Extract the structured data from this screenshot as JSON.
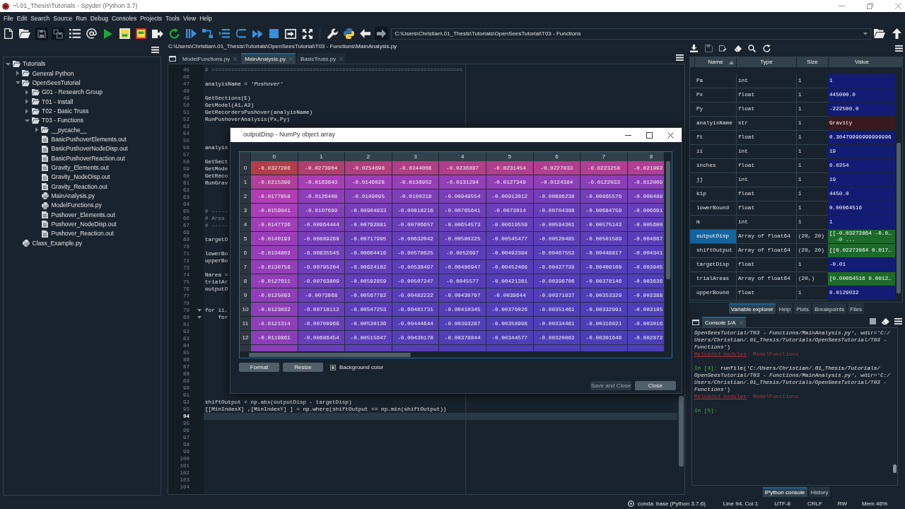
{
  "window": {
    "title": "~\\.01_Thesis\\Tutorials - Spyder (Python 3.7)"
  },
  "menu": [
    "File",
    "Edit",
    "Search",
    "Source",
    "Run",
    "Debug",
    "Consoles",
    "Projects",
    "Tools",
    "View",
    "Help"
  ],
  "toolbar": {
    "path": "C:\\Users\\Christian\\.01_Thesis\\Tutorials\\OpenSeesTutorial\\T03 - Functions"
  },
  "project_tree": {
    "items": [
      {
        "label": "Tutorials",
        "kind": "folder",
        "expanded": true,
        "children": [
          {
            "label": "General Python",
            "kind": "folder",
            "expanded": false
          },
          {
            "label": "OpenSeesTutorial",
            "kind": "folder",
            "expanded": true,
            "children": [
              {
                "label": "G01 - Research Group",
                "kind": "folder",
                "expanded": false
              },
              {
                "label": "T01 - Install",
                "kind": "folder",
                "expanded": false
              },
              {
                "label": "T02 - Basic Truss",
                "kind": "folder",
                "expanded": false
              },
              {
                "label": "T03 - Functions",
                "kind": "folder",
                "expanded": true,
                "children": [
                  {
                    "label": "__pycache__",
                    "kind": "folder",
                    "expanded": false
                  },
                  {
                    "label": "BasicPushoverElements.out",
                    "kind": "file"
                  },
                  {
                    "label": "BasicPushoverNodeDisp.out",
                    "kind": "file"
                  },
                  {
                    "label": "BasicPushoverReaction.out",
                    "kind": "file"
                  },
                  {
                    "label": "Gravity_Elements.out",
                    "kind": "file"
                  },
                  {
                    "label": "Gravity_NodeDisp.out",
                    "kind": "file"
                  },
                  {
                    "label": "Gravity_Reaction.out",
                    "kind": "file"
                  },
                  {
                    "label": "MainAnalysis.py",
                    "kind": "python"
                  },
                  {
                    "label": "ModelFunctions.py",
                    "kind": "python"
                  },
                  {
                    "label": "Pushover_Elements.out",
                    "kind": "file"
                  },
                  {
                    "label": "Pushover_NodeDisp.out",
                    "kind": "file"
                  },
                  {
                    "label": "Pushover_Reaction.out",
                    "kind": "file"
                  }
                ]
              }
            ]
          },
          {
            "label": "Class_Example.py",
            "kind": "python"
          }
        ]
      }
    ]
  },
  "editor": {
    "path": "C:\\Users\\Christian\\.01_Thesis\\Tutorials\\OpenSeesTutorial\\T03 - Functions\\MainAnalysis.py",
    "tabs": [
      {
        "label": "ModelFunctions.py",
        "selected": false
      },
      {
        "label": "MainAnalysis.py",
        "selected": true
      },
      {
        "label": "BasicTruss.py",
        "selected": false
      }
    ],
    "lines": [
      {
        "number": "45",
        "kind": "comment",
        "text": "# =============================================================================",
        "current": false
      },
      {
        "number": "46",
        "kind": "blank",
        "current": false
      },
      {
        "number": "47",
        "kind": "code",
        "text": "analyisName = *'Pushover'*",
        "current": false
      },
      {
        "number": "48",
        "kind": "blank",
        "current": false
      },
      {
        "number": "49",
        "kind": "code",
        "text": "GetSections(E)",
        "current": false
      },
      {
        "number": "50",
        "kind": "code",
        "text": "GetModel(A1,A2)",
        "current": false
      },
      {
        "number": "51",
        "kind": "code",
        "text": "GetRecordersPushover(analyisName)",
        "current": false
      },
      {
        "number": "52",
        "kind": "code",
        "text": "RunPushoverAnalysis(Px,Py)",
        "current": false
      },
      {
        "number": "53",
        "kind": "blank",
        "current": false
      },
      {
        "number": "54",
        "kind": "blank",
        "current": false
      },
      {
        "number": "55",
        "kind": "blank",
        "current": false
      },
      {
        "number": "56",
        "kind": "code",
        "text": "analyis",
        "current": false
      },
      {
        "number": "57",
        "kind": "blank",
        "current": false
      },
      {
        "number": "58",
        "kind": "code",
        "text": "GetSect",
        "current": false
      },
      {
        "number": "59",
        "kind": "code",
        "text": "GetMode",
        "current": false
      },
      {
        "number": "60",
        "kind": "code",
        "text": "GetReco",
        "current": false
      },
      {
        "number": "61",
        "kind": "code",
        "text": "RunGrav",
        "current": false
      },
      {
        "number": "62",
        "kind": "blank",
        "current": false
      },
      {
        "number": "63",
        "kind": "blank",
        "current": false
      },
      {
        "number": "64",
        "kind": "blank",
        "current": false
      },
      {
        "number": "65",
        "kind": "comment",
        "text": "# -----",
        "current": false
      },
      {
        "number": "66",
        "kind": "comment",
        "text": "# Area",
        "current": false
      },
      {
        "number": "67",
        "kind": "comment",
        "text": "# -----",
        "current": false
      },
      {
        "number": "68",
        "kind": "blank",
        "current": false
      },
      {
        "number": "69",
        "kind": "code",
        "text": "targetD",
        "current": false
      },
      {
        "number": "70",
        "kind": "blank",
        "current": false
      },
      {
        "number": "71",
        "kind": "code",
        "text": "lowerBo",
        "current": false
      },
      {
        "number": "72",
        "kind": "code",
        "text": "upperBo",
        "current": false
      },
      {
        "number": "73",
        "kind": "blank",
        "current": false
      },
      {
        "number": "74",
        "kind": "code",
        "text": "Narea =",
        "current": false
      },
      {
        "number": "75",
        "kind": "code",
        "text": "trialAr",
        "current": false
      },
      {
        "number": "76",
        "kind": "code",
        "text": "outputD",
        "current": false
      },
      {
        "number": "77",
        "kind": "blank",
        "current": false
      },
      {
        "number": "78",
        "kind": "blank",
        "current": false
      },
      {
        "number": "79",
        "kind": "block_start",
        "text": "for ii,",
        "current": false
      },
      {
        "number": "80",
        "kind": "block_start",
        "text": "    for",
        "current": false
      },
      {
        "number": "81",
        "kind": "blank",
        "current": false
      },
      {
        "number": "82",
        "kind": "blank",
        "current": false
      },
      {
        "number": "83",
        "kind": "blank",
        "current": false
      },
      {
        "number": "84",
        "kind": "blank",
        "current": false
      },
      {
        "number": "85",
        "kind": "blank",
        "current": false
      },
      {
        "number": "86",
        "kind": "blank",
        "current": false
      },
      {
        "number": "87",
        "kind": "blank",
        "current": false
      },
      {
        "number": "88",
        "kind": "blank",
        "current": false
      },
      {
        "number": "89",
        "kind": "blank",
        "current": false
      },
      {
        "number": "90",
        "kind": "blank",
        "current": false
      },
      {
        "number": "91",
        "kind": "blank",
        "current": false
      },
      {
        "number": "92",
        "kind": "code",
        "text": "shiftOutput = np.abs(outputDisp - targetDisp)",
        "current": false
      },
      {
        "number": "93",
        "kind": "code",
        "text": "[[MinIndexX] ,[MinIndexY] ] = np.where(shiftOutput == np.min(shiftOutput))",
        "current": false
      },
      {
        "number": "94",
        "kind": "blank",
        "current": true
      },
      {
        "number": "95",
        "kind": "blank",
        "current": false
      },
      {
        "number": "96",
        "kind": "blank",
        "current": false
      },
      {
        "number": "97",
        "kind": "blank",
        "current": false
      },
      {
        "number": "98",
        "kind": "blank",
        "current": false
      },
      {
        "number": "99",
        "kind": "blank",
        "current": false
      },
      {
        "number": "100",
        "kind": "blank",
        "current": false
      },
      {
        "number": "101",
        "kind": "blank",
        "current": false
      },
      {
        "number": "102",
        "kind": "blank",
        "current": false
      },
      {
        "number": "103",
        "kind": "blank",
        "current": false
      },
      {
        "number": "104",
        "kind": "blank",
        "current": false
      }
    ]
  },
  "array_editor": {
    "title": "outputDisp - NumPy object array",
    "columns": [
      "0",
      "1",
      "2",
      "3",
      "4",
      "5",
      "6",
      "7",
      "8"
    ],
    "rows": [
      {
        "header": "0",
        "cells": [
          "-0.0327286",
          "-0.0273904",
          "-0.0254698",
          "-0.0244066",
          "-0.0236887",
          "-0.0231454",
          "-0.0227033",
          "-0.0223258",
          "-0.021992"
        ]
      },
      {
        "header": "1",
        "cells": [
          "-0.0215399",
          "-0.0163643",
          "-0.0146028",
          "-0.0136952",
          "-0.0131294",
          "-0.0127349",
          "-0.0124384",
          "-0.0122033",
          "-0.012009"
        ]
      },
      {
        "header": "2",
        "cells": [
          "-0.0177858",
          "-0.0126408",
          "-0.0109095",
          "-0.0100318",
          "-0.00949554",
          "-0.00913012",
          "-0.00886238",
          "-0.00865576",
          "-0.008489"
        ]
      },
      {
        "header": "3",
        "cells": [
          "-0.0159041",
          "-0.0107699",
          "-0.00904933",
          "-0.00818216",
          "-0.00765641",
          "-0.0073014",
          "-0.00704398",
          "-0.00684759",
          "-0.006691"
        ]
      },
      {
        "header": "4",
        "cells": [
          "-0.0147736",
          "-0.00964444",
          "-0.00792881",
          "-0.00706657",
          "-0.00654573",
          "-0.00619559",
          "-0.00594301",
          "-0.00575143",
          "-0.005600"
        ]
      },
      {
        "header": "5",
        "cells": [
          "-0.0140193",
          "-0.00889288",
          "-0.00717995",
          "-0.00632042",
          "-0.00580225",
          "-0.00545477",
          "-0.00520485",
          "-0.00501589",
          "-0.004867"
        ]
      },
      {
        "header": "6",
        "cells": [
          "-0.0134802",
          "-0.00835545",
          "-0.00664416",
          "-0.00578625",
          "-0.0052697",
          "-0.00492384",
          "-0.00467552",
          "-0.00448817",
          "-0.004341"
        ]
      },
      {
        "header": "7",
        "cells": [
          "-0.0130758",
          "-0.00795204",
          "-0.00624182",
          "-0.00538497",
          "-0.00486947",
          "-0.00452466",
          "-0.00427739",
          "-0.00409108",
          "-0.003945"
        ]
      },
      {
        "header": "8",
        "cells": [
          "-0.0127611",
          "-0.00763809",
          "-0.00592859",
          "-0.00507247",
          "-0.0045577",
          "-0.00421361",
          "-0.00396706",
          "-0.00378146",
          "-0.003636"
        ]
      },
      {
        "header": "9",
        "cells": [
          "-0.0125093",
          "-0.0073868",
          "-0.00567782",
          "-0.00482222",
          "-0.00430797",
          "-0.0039644",
          "-0.00371837",
          "-0.00353329",
          "-0.003388"
        ]
      },
      {
        "header": "10",
        "cells": [
          "-0.0123032",
          "-0.00718112",
          "-0.00547253",
          "-0.00461731",
          "-0.00410345",
          "-0.00376026",
          "-0.00351461",
          "-0.00332991",
          "-0.003185"
        ]
      },
      {
        "header": "11",
        "cells": [
          "-0.0121314",
          "-0.00700966",
          "-0.00530136",
          "-0.00444644",
          "-0.00393287",
          "-0.00358998",
          "-0.00334461",
          "-0.00316021",
          "-0.003016"
        ]
      },
      {
        "header": "12",
        "cells": [
          "-0.0119861",
          "-0.00686454",
          "-0.00515647",
          "-0.00430178",
          "-0.00378844",
          "-0.00344577",
          "-0.00320063",
          "-0.00301646",
          "-0.002872"
        ]
      }
    ],
    "buttons": [
      "Format",
      "Resize"
    ],
    "background_color": {
      "label": "Background color",
      "checked": true
    },
    "dialog_buttons": [
      {
        "label": "Save and Close",
        "disabled": true
      },
      {
        "label": "Close",
        "disabled": false
      }
    ]
  },
  "variable_explorer": {
    "columns": [
      {
        "label": "Name",
        "sorted": true
      },
      {
        "label": "Type",
        "sorted": false
      },
      {
        "label": "Size",
        "sorted": false
      },
      {
        "label": "Value",
        "sorted": false
      }
    ],
    "variables": [
      {
        "name": "Pa",
        "type": "int",
        "size": "1",
        "value": "1",
        "color": "#131c75",
        "selected": false
      },
      {
        "name": "Px",
        "type": "float",
        "size": "1",
        "value": "445000.0",
        "color": "#131c75",
        "selected": false
      },
      {
        "name": "Py",
        "type": "float",
        "size": "1",
        "value": "-222500.0",
        "color": "#131c75",
        "selected": false
      },
      {
        "name": "analyisName",
        "type": "str",
        "size": "1",
        "value": "Gravity",
        "color": "#3b1a1f",
        "selected": false
      },
      {
        "name": "ft",
        "type": "float",
        "size": "1",
        "value": "0.30479999999999996",
        "color": "#131c75",
        "selected": false
      },
      {
        "name": "ii",
        "type": "int",
        "size": "1",
        "value": "19",
        "color": "#131c75",
        "selected": false
      },
      {
        "name": "inches",
        "type": "float",
        "size": "1",
        "value": "0.0254",
        "color": "#131c75",
        "selected": false
      },
      {
        "name": "jj",
        "type": "int",
        "size": "1",
        "value": "19",
        "color": "#131c75",
        "selected": false
      },
      {
        "name": "kip",
        "type": "float",
        "size": "1",
        "value": "4450.0",
        "color": "#131c75",
        "selected": false
      },
      {
        "name": "lowerBound",
        "type": "float",
        "size": "1",
        "value": "0.00064516",
        "color": "#131c75",
        "selected": false
      },
      {
        "name": "m",
        "type": "int",
        "size": "1",
        "value": "1",
        "color": "#131c75",
        "selected": false
      },
      {
        "name": "outputDisp",
        "type": "Array of float64",
        "size": "(20, 20)",
        "value": "[[-0.03272864 -0.0…\n  -0 ...",
        "color": "#1d6a2b",
        "selected": true
      },
      {
        "name": "shiftOutput",
        "type": "Array of float64",
        "size": "(20, 20)",
        "value": "[[0.02272864 0.017…",
        "color": "#1d6a2b",
        "selected": false
      },
      {
        "name": "targetDisp",
        "type": "float",
        "size": "1",
        "value": "-0.01",
        "color": "#131c75",
        "selected": false
      },
      {
        "name": "trialAreas",
        "type": "Array of float64",
        "size": "(20,)",
        "value": "[0.00064516 0.0012…",
        "color": "#1d6a2b",
        "selected": false
      },
      {
        "name": "upperBound",
        "type": "float",
        "size": "1",
        "value": "0.0129032",
        "color": "#131c75",
        "selected": false
      }
    ],
    "tabs": [
      {
        "label": "Variable explorer",
        "selected": true
      },
      {
        "label": "Help",
        "selected": false
      },
      {
        "label": "Plots",
        "selected": false
      },
      {
        "label": "Breakpoints",
        "selected": false
      },
      {
        "label": "Files",
        "selected": false
      }
    ]
  },
  "console": {
    "tab": "Console 1/A",
    "lines": [
      {
        "kind": "output",
        "text": "*OpenSeesTutorial/T03 - Functions/MainAnalysis.py'*, wdir=*'C:/*"
      },
      {
        "kind": "output",
        "text": "*Users/Christian/.01_Thesis/Tutorials/OpenSeesTutorial/T03 -*"
      },
      {
        "kind": "output",
        "text": "*Functions'*)"
      },
      {
        "kind": "notice",
        "link": "Reloaded modules",
        "text": ": ModelFunctions"
      },
      {
        "kind": "blank"
      },
      {
        "kind": "prompt",
        "prompt": "In [4]:",
        "text": "runfile(*'C:/Users/Christian/.01_Thesis/Tutorials/*"
      },
      {
        "kind": "output",
        "text": "*OpenSeesTutorial/T03 - Functions/MainAnalysis.py'*, wdir=*'C:/*"
      },
      {
        "kind": "output",
        "text": "*Users/Christian/.01_Thesis/Tutorials/OpenSeesTutorial/T03 -*"
      },
      {
        "kind": "output",
        "text": "*Functions'*)"
      },
      {
        "kind": "notice",
        "link": "Reloaded modules",
        "text": ": ModelFunctions"
      },
      {
        "kind": "blank"
      },
      {
        "kind": "prompt",
        "prompt": "In [5]:"
      }
    ],
    "tabs": [
      {
        "label": "IPython console",
        "selected": true
      },
      {
        "label": "History",
        "selected": false
      }
    ]
  },
  "status_bar": {
    "interpreter": "conda: base (Python 3.7.6)",
    "cursor": "Line 94, Col 1",
    "encoding": "UTF-8",
    "line_endings": "CRLF",
    "permissions": "RW",
    "memory": "Mem 46%"
  }
}
